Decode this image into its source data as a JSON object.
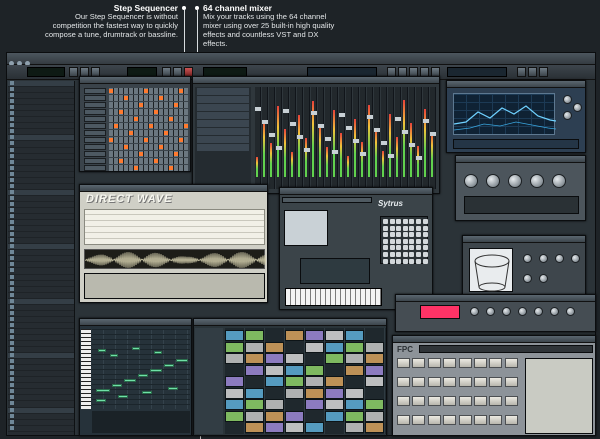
{
  "callouts": {
    "step_sequencer": {
      "title": "Step Sequencer",
      "body": "Our Step Sequencer is without competition the fastest way to quickly compose a tune, drumtrack or bassline."
    },
    "mixer": {
      "title": "64 channel mixer",
      "body": "Mix your tracks using the 64 channel mixer using over 25 built-in high quality effects and countless VST and DX effects."
    }
  },
  "plugins": {
    "direct_wave": "DIRECT WAVE",
    "sytrus": "Sytrus",
    "fpc": "FPC"
  },
  "colors": {
    "accent": "#ff7a2f",
    "note": "#6fe0a7",
    "analyzer": "#0f2234"
  }
}
